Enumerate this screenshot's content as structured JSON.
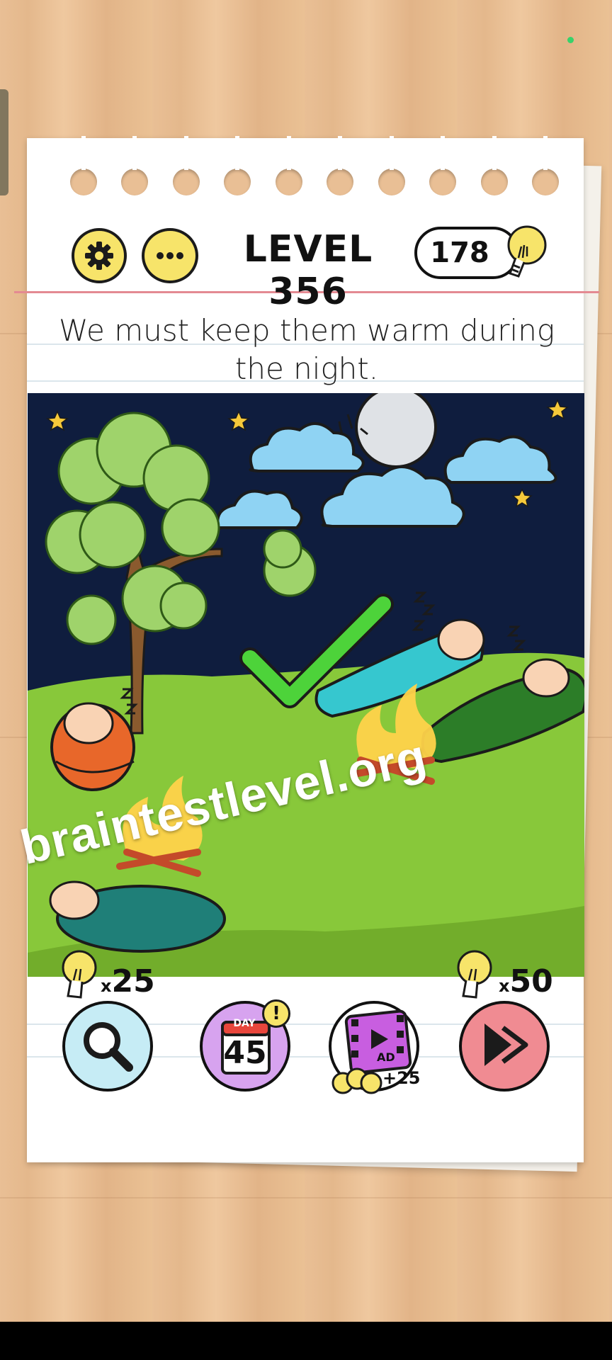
{
  "header": {
    "settings_icon": "gear-icon",
    "more_icon": "ellipsis-icon",
    "level_label": "LEVEL 356",
    "hint_count": "178",
    "hint_icon": "lightbulb-icon"
  },
  "question": {
    "text": "We must keep them warm during the night."
  },
  "puzzle": {
    "result_icon": "checkmark-icon",
    "state": "solved"
  },
  "watermark": {
    "text": "braintestlevel.org"
  },
  "toolbar": {
    "hint": {
      "icon": "magnifier-icon",
      "cost": "25",
      "cost_prefix": "x"
    },
    "daily": {
      "icon": "calendar-icon",
      "day_word": "DAY",
      "day_number": "45",
      "alert": "!"
    },
    "ad": {
      "icon": "video-ad-icon",
      "badge": "AD",
      "reward": "+25"
    },
    "skip": {
      "icon": "skip-icon",
      "cost": "50",
      "cost_prefix": "x"
    }
  },
  "colors": {
    "bulb_yellow": "#f7e46a",
    "grass": "#88c83a",
    "night_sky": "#0f1d3e",
    "check_green": "#4dd33a",
    "paper_red_rule": "#e48a92"
  }
}
